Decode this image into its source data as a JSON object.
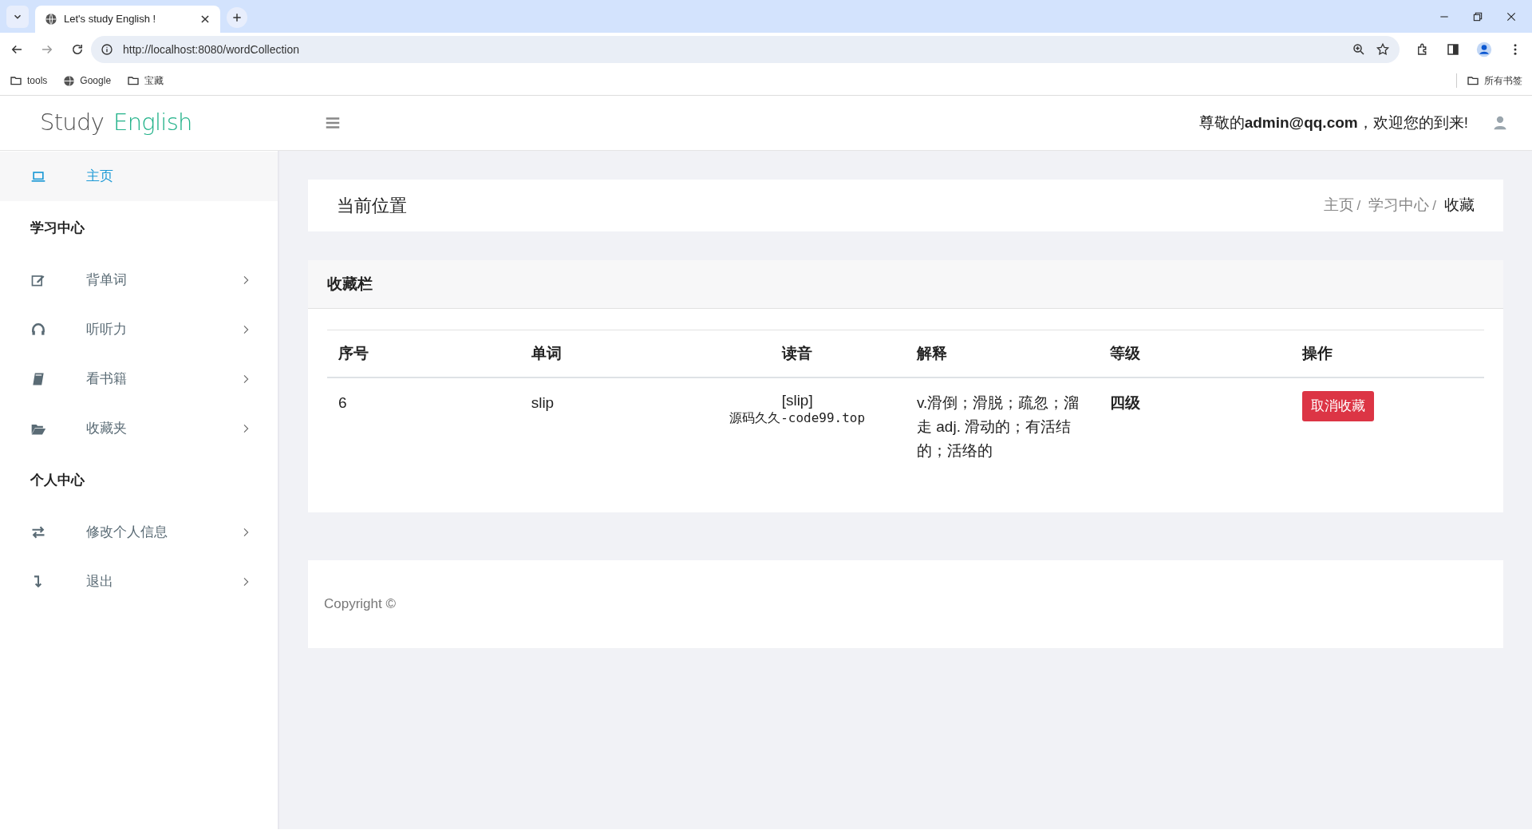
{
  "browser": {
    "tab_title": "Let's study English !",
    "url": "http://localhost:8080/wordCollection",
    "bookmarks": [
      {
        "label": "tools",
        "kind": "folder"
      },
      {
        "label": "Google",
        "kind": "site"
      },
      {
        "label": "宝藏",
        "kind": "folder"
      }
    ],
    "all_bookmarks": "所有书签"
  },
  "header": {
    "logo_first": "Study",
    "logo_second": "English",
    "greeting": "尊敬的**admin@qq.com**，欢迎您的到来!"
  },
  "sidebar": [
    {
      "kind": "item",
      "label": "主页",
      "selected": true
    },
    {
      "kind": "heading",
      "label": "学习中心"
    },
    {
      "kind": "item",
      "label": "背单词",
      "selected": false
    },
    {
      "kind": "item",
      "label": "听听力",
      "selected": false
    },
    {
      "kind": "item",
      "label": "看书籍",
      "selected": false
    },
    {
      "kind": "item",
      "label": "收藏夹",
      "selected": false
    },
    {
      "kind": "heading",
      "label": "个人中心"
    },
    {
      "kind": "item",
      "label": "修改个人信息",
      "selected": false
    },
    {
      "kind": "item",
      "label": "退出",
      "selected": false
    }
  ],
  "location": {
    "title": "当前位置",
    "breadcrumb": [
      "主页",
      "学习中心",
      "收藏"
    ],
    "separator": "/"
  },
  "collection": {
    "title": "收藏栏",
    "columns": [
      "序号",
      "单词",
      "读音",
      "解释",
      "等级",
      "操作"
    ],
    "rows": [
      {
        "index": "6",
        "word": "slip",
        "reading": "[slip]",
        "reading_note": "源码久久-code99.top",
        "meaning": "v.滑倒；滑脱；疏忽；溜走 adj. 滑动的；有活结的；活络的",
        "level": "四级",
        "action": "取消收藏"
      }
    ]
  },
  "footer": {
    "copyright": "Copyright ©"
  }
}
